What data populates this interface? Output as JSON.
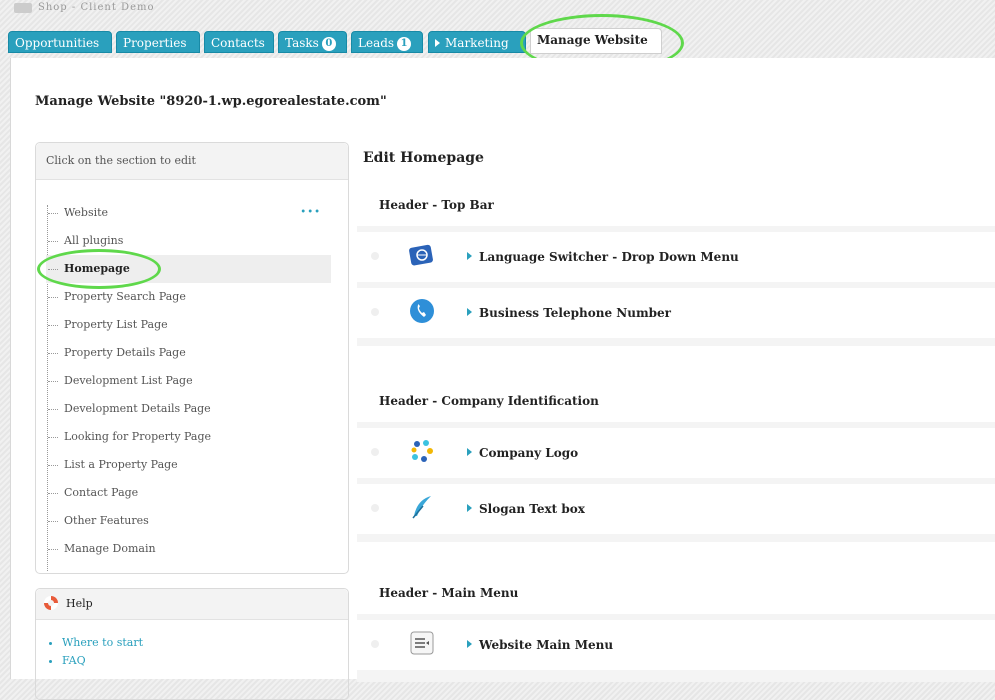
{
  "app": {
    "title": "Shop - Client Demo"
  },
  "tabs": [
    {
      "label": "Opportunities"
    },
    {
      "label": "Properties"
    },
    {
      "label": "Contacts"
    },
    {
      "label": "Tasks",
      "badge": "0"
    },
    {
      "label": "Leads",
      "badge": "1"
    },
    {
      "label": "Marketing"
    },
    {
      "label": "Manage Website",
      "active": true
    }
  ],
  "page": {
    "title": "Manage Website \"8920-1.wp.egorealestate.com\""
  },
  "sidebar": {
    "header": "Click on the section to edit",
    "items": [
      {
        "label": "Website"
      },
      {
        "label": "All plugins"
      },
      {
        "label": "Homepage"
      },
      {
        "label": "Property Search Page"
      },
      {
        "label": "Property List Page"
      },
      {
        "label": "Property Details Page"
      },
      {
        "label": "Development List Page"
      },
      {
        "label": "Development Details Page"
      },
      {
        "label": "Looking for Property Page"
      },
      {
        "label": "List a Property Page"
      },
      {
        "label": "Contact Page"
      },
      {
        "label": "Other Features"
      },
      {
        "label": "Manage Domain"
      }
    ],
    "selected": "Homepage",
    "more_label": "•••"
  },
  "help": {
    "title": "Help",
    "links": [
      {
        "label": "Where to start"
      },
      {
        "label": "FAQ"
      }
    ]
  },
  "editor": {
    "title": "Edit Homepage",
    "sections": [
      {
        "title": "Header - Top Bar",
        "items": [
          {
            "label": "Language Switcher - Drop Down Menu",
            "icon": "language-icon"
          },
          {
            "label": "Business Telephone Number",
            "icon": "phone-icon"
          }
        ]
      },
      {
        "title": "Header - Company Identification",
        "items": [
          {
            "label": "Company Logo",
            "icon": "logo-icon"
          },
          {
            "label": "Slogan Text box",
            "icon": "feather-icon"
          }
        ]
      },
      {
        "title": "Header - Main Menu",
        "items": [
          {
            "label": "Website Main Menu",
            "icon": "menu-icon"
          }
        ]
      }
    ]
  },
  "colors": {
    "accent": "#2aa0bd",
    "highlight": "#5fd84b"
  }
}
